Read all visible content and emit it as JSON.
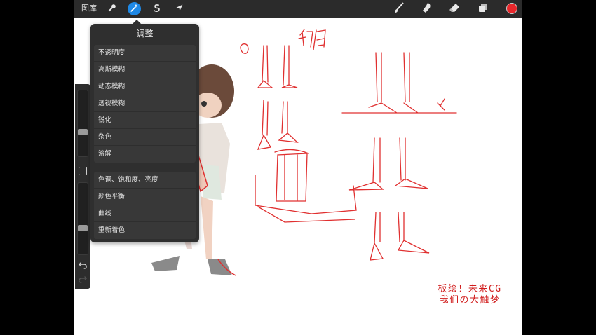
{
  "topbar": {
    "gallery_label": "图库",
    "tools_left": [
      {
        "name": "actions",
        "icon": "wrench-icon"
      },
      {
        "name": "adjustments",
        "icon": "magic-wand-icon",
        "active": true
      },
      {
        "name": "selection",
        "icon": "selection-s-icon"
      },
      {
        "name": "transform",
        "icon": "arrow-cursor-icon"
      }
    ],
    "tools_right": [
      {
        "name": "brush",
        "icon": "brush-icon"
      },
      {
        "name": "smudge",
        "icon": "smudge-finger-icon"
      },
      {
        "name": "eraser",
        "icon": "eraser-icon"
      },
      {
        "name": "layers",
        "icon": "layers-icon"
      }
    ],
    "current_color": "#e8272b",
    "active_color": "#1e88e5"
  },
  "adjustments": {
    "title": "调整",
    "group1": [
      "不透明度",
      "高斯模糊",
      "动态模糊",
      "透视模糊",
      "锐化",
      "杂色",
      "溶解"
    ],
    "group2": [
      "色调、饱和度、亮度",
      "颜色平衡",
      "曲线",
      "重新着色"
    ]
  },
  "sidebar": {
    "brush_size_level": 0.35,
    "opacity_level": 0.35,
    "icons": [
      "modify-square-icon",
      "undo-icon",
      "redo-icon"
    ]
  },
  "canvas": {
    "sketch_title": "初角",
    "circle_note": "a"
  },
  "watermark": {
    "line1": "板绘！未来CG",
    "line2": "我们の大触梦"
  },
  "colors": {
    "sketch_red": "#e03030",
    "watermark_red": "#d11d1d"
  }
}
